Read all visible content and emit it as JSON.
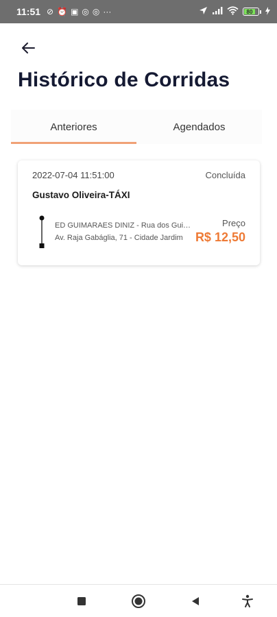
{
  "status_bar": {
    "time": "11:51",
    "notification_glyphs": [
      "⊘",
      "⏰",
      "▣",
      "◎",
      "◎",
      "···"
    ],
    "battery_level": "80"
  },
  "header": {
    "title": "Histórico de Corridas"
  },
  "tabs": [
    {
      "label": "Anteriores",
      "active": true
    },
    {
      "label": "Agendados",
      "active": false
    }
  ],
  "rides": [
    {
      "datetime": "2022-07-04 11:51:00",
      "status": "Concluída",
      "driver": "Gustavo Oliveira-TÁXI",
      "origin": "ED GUIMARAES DINIZ - Rua dos Guimarães",
      "destination": "Av. Raja Gabáglia, 71 - Cidade Jardim",
      "price_label": "Preço",
      "price": "R$ 12,50"
    }
  ],
  "colors": {
    "accent": "#ee7a35",
    "tab_indicator": "#f0a176",
    "title": "#151a33",
    "status_bar": "#6e6e6e"
  },
  "icons": {
    "back": "arrow-left-icon",
    "nav_recents": "square-icon",
    "nav_home": "circle-icon",
    "nav_back": "triangle-left-icon",
    "nav_accessibility": "accessibility-icon"
  }
}
